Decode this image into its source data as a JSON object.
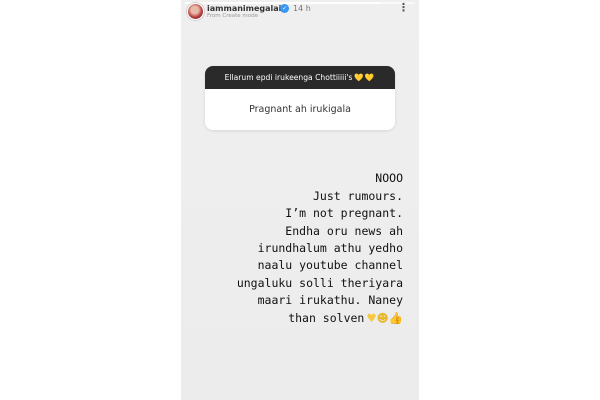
{
  "story": {
    "progress": 0.85,
    "header": {
      "username": "iammanimegalai",
      "verified_icon": "verified-badge-icon",
      "time": "14 h",
      "subtitle": "From Create mode",
      "more_icon": "more-options-icon"
    },
    "question": {
      "prompt": "Ellarum epdi irukeenga Chottiiiii's",
      "prompt_emoji": "💛💛",
      "answer": "Pragnant ah irukigala"
    },
    "reply": {
      "text": "NOOO\nJust rumours.\nI’m not pregnant.\nEndha oru news ah\nirundhalum athu yedho\nnaalu youtube channel\nungaluku solli theriyara\nmaari irukathu. Naney\nthan solven",
      "emoji_icons": [
        "yellow-heart-icon",
        "sunglasses-face-icon",
        "thumbs-up-icon"
      ]
    }
  }
}
